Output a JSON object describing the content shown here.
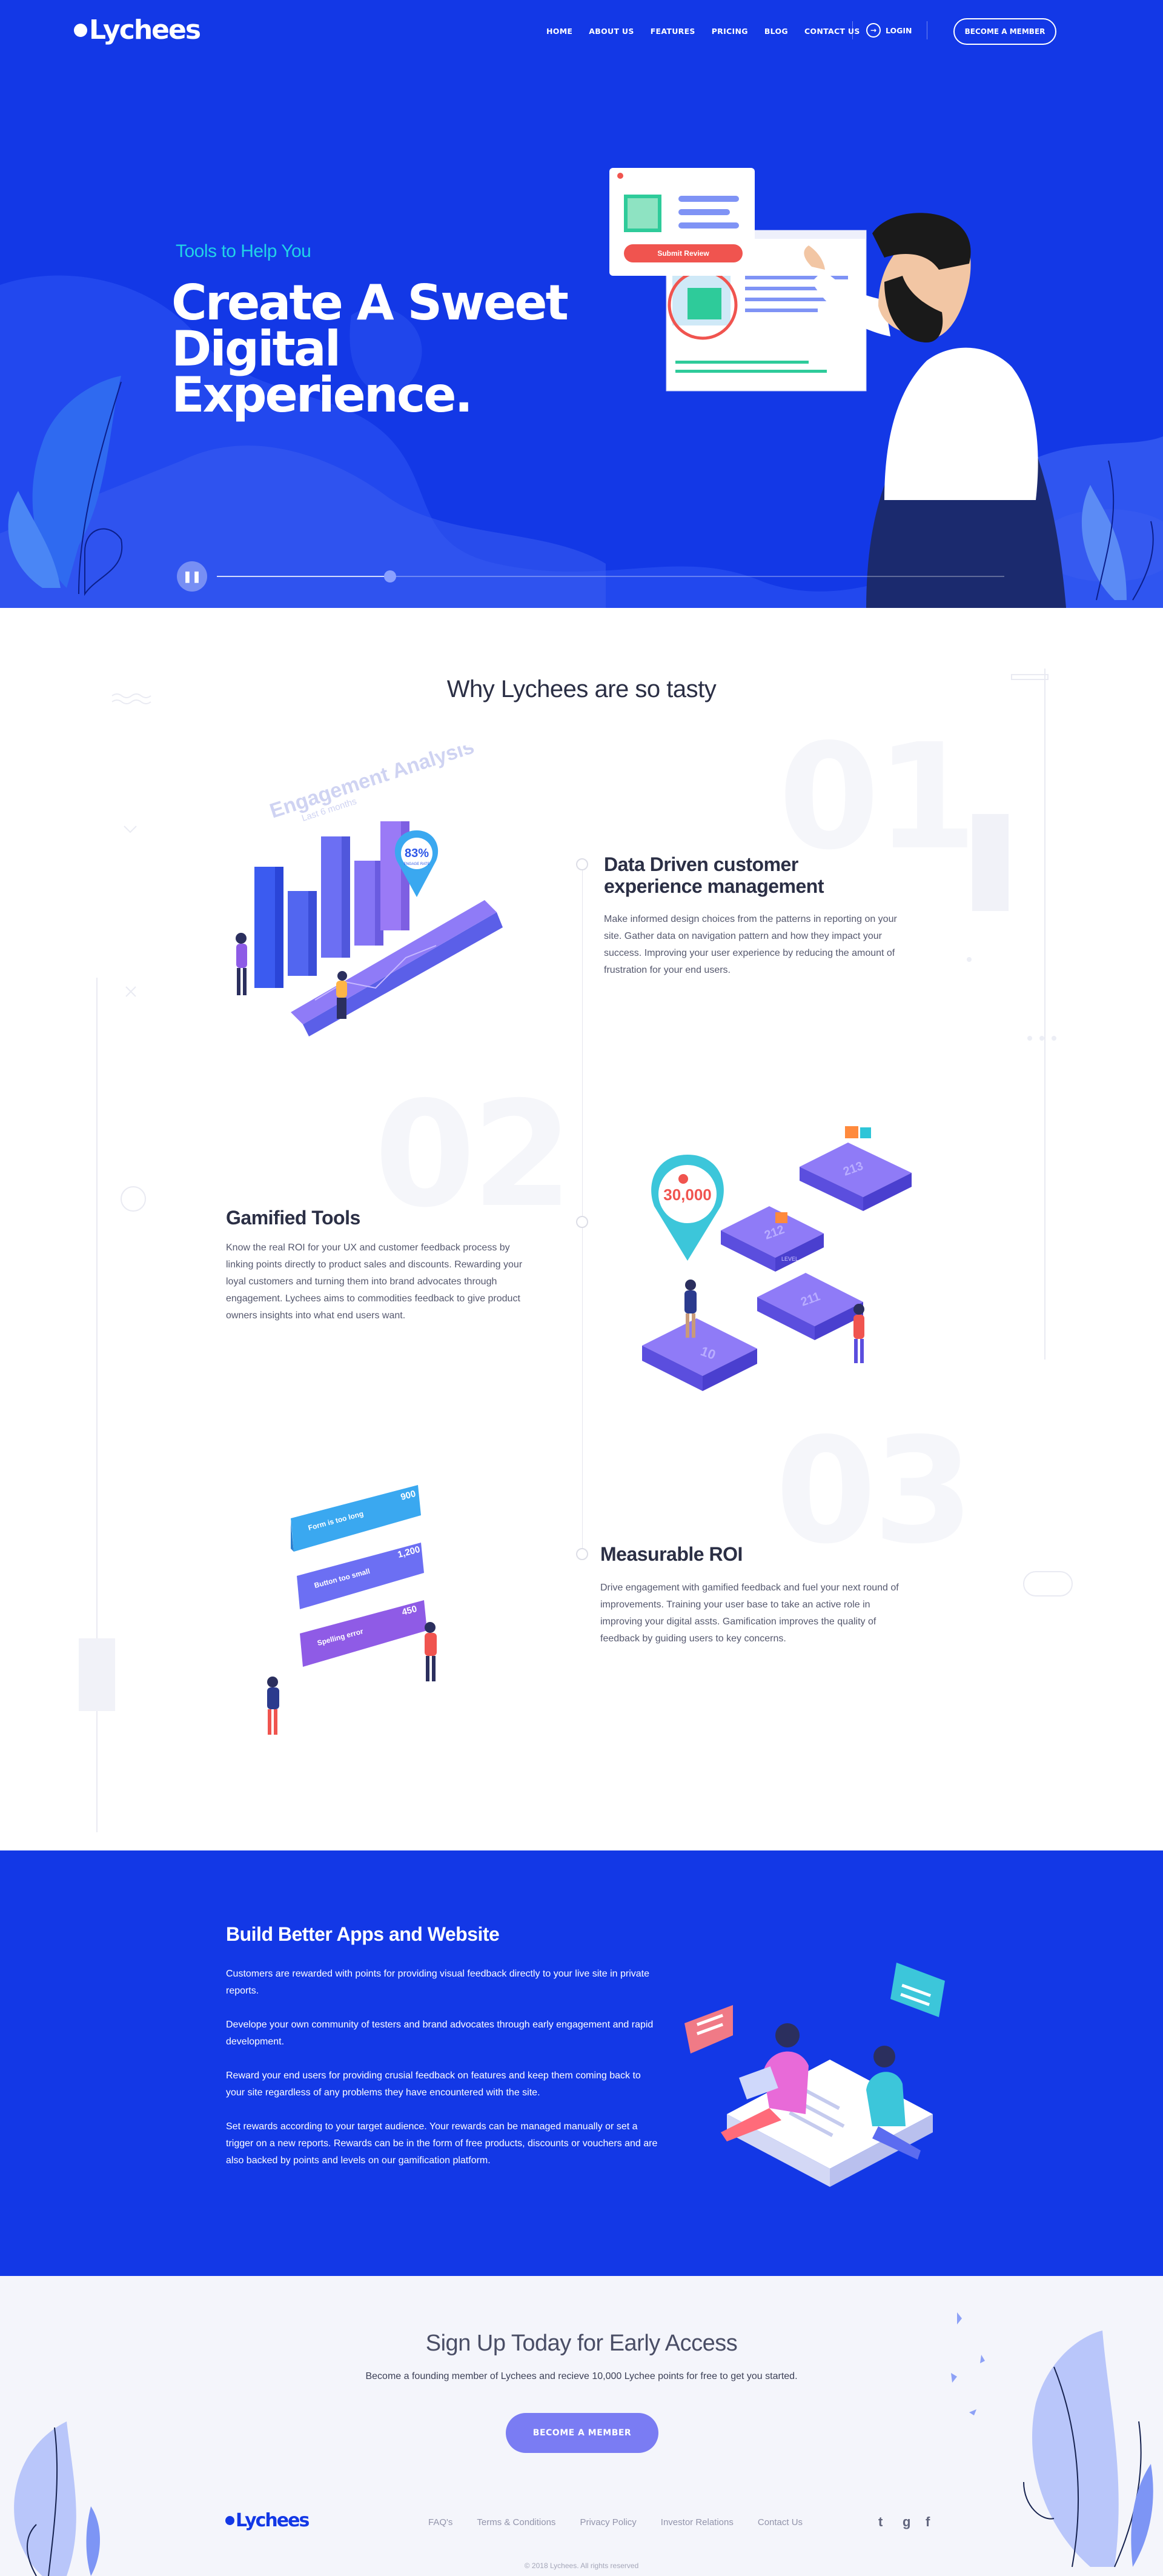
{
  "brand": {
    "name": "Lychees",
    "primary_color": "#1338e6",
    "accent_color": "#22d3e6",
    "button_color": "#7a7cf3"
  },
  "nav": {
    "items": [
      "HOME",
      "ABOUT US",
      "FEATURES",
      "PRICING",
      "BLOG",
      "CONTACT US"
    ],
    "login_label": "LOGIN",
    "cta_label": "BECOME A MEMBER"
  },
  "hero": {
    "subtitle": "Tools to Help You",
    "title_line1": "Create A Sweet",
    "title_line2": "Digital Experience.",
    "card_button": "Submit Review",
    "slider_progress": 0.22
  },
  "why": {
    "title": "Why Lychees are so tasty",
    "features": [
      {
        "number": "01",
        "title_line1": "Data Driven customer",
        "title_line2": "experience management",
        "text": "Make informed design choices from the patterns in reporting on your site. Gather data on navigation pattern and how they impact your success. Improving your user experience by reducing the amount of frustration for your end users.",
        "illustration": {
          "heading": "Engagement Analysis",
          "subheading": "Last 6 months",
          "percent": "83%",
          "percent_caption": "ENGAGE RATE"
        }
      },
      {
        "number": "02",
        "title_line1": "Gamified Tools",
        "title_line2": "",
        "text": "Know the real ROI for your UX and customer feedback process by linking points directly to product sales and discounts. Rewarding your loyal customers and turning them into brand advocates through engagement. Lychees aims to commodities feedback to give product owners insights into what end users want.",
        "illustration": {
          "points": "30,000",
          "levels": [
            "10",
            "211",
            "212",
            "213"
          ],
          "level_label": "LEVEL"
        }
      },
      {
        "number": "03",
        "title_line1": "Measurable ROI",
        "title_line2": "",
        "text": "Drive engagement with gamified feedback and fuel your next round of improvements. Training your user base to take an active role in improving your digital assts. Gamification improves the quality of feedback by guiding users to key concerns.",
        "illustration": {
          "cards": [
            {
              "label": "Form is too long",
              "value": "900"
            },
            {
              "label": "Button too small",
              "value": "1,200"
            },
            {
              "label": "Spelling error",
              "value": "450"
            }
          ]
        }
      }
    ]
  },
  "build": {
    "title": "Build Better Apps and Website",
    "paragraphs": [
      "Customers are rewarded with points for providing visual feedback directly to your live site in private reports.",
      "Develope your own community of testers and brand advocates through early engagement and rapid development.",
      "Reward your end users for providing crusial feedback on features and keep them coming back to your site regardless of any problems they have encountered with the site.",
      "Set rewards according to your target audience. Your rewards can be managed manually or set a trigger on a new reports. Rewards can be in the form of free products, discounts or vouchers and are also backed by points and levels on our gamification platform."
    ]
  },
  "signup": {
    "title": "Sign Up Today for Early Access",
    "subtitle": "Become a founding member of Lychees and recieve 10,000 Lychee points for free to get you started.",
    "button": "BECOME A MEMBER"
  },
  "footer": {
    "links": [
      "FAQ's",
      "Terms & Conditions",
      "Privacy Policy",
      "Investor Relations",
      "Contact Us"
    ],
    "social": [
      {
        "icon": "twitter-icon",
        "glyph": "t"
      },
      {
        "icon": "google-icon",
        "glyph": "g"
      },
      {
        "icon": "facebook-icon",
        "glyph": "f"
      }
    ],
    "copyright": "© 2018 Lychees. All rights reserved"
  }
}
